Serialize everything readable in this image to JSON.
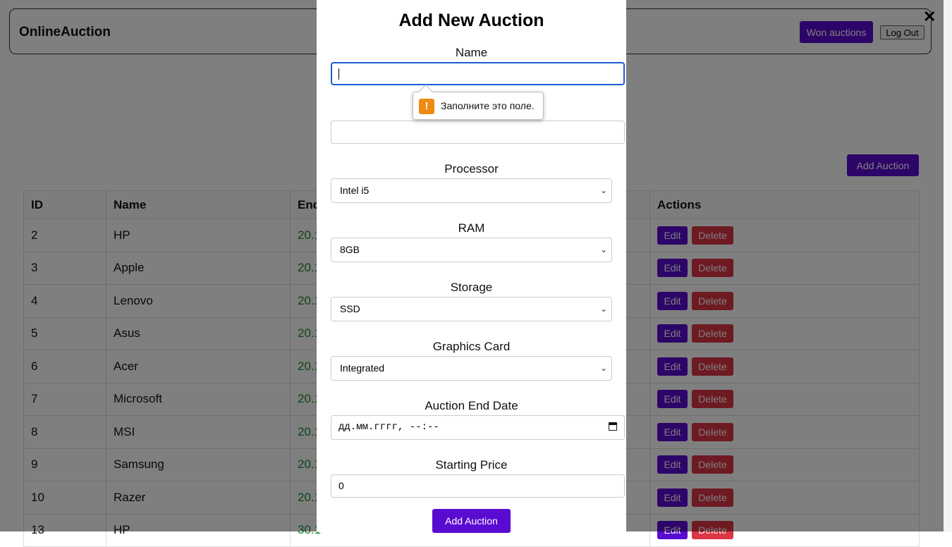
{
  "app": {
    "brand": "OnlineAuction",
    "won_auctions_label": "Won auctions",
    "logout_label": "Log Out",
    "add_auction_label": "Add Auction"
  },
  "table": {
    "headers": [
      "ID",
      "Name",
      "End",
      "Actions"
    ],
    "edit_label": "Edit",
    "delete_label": "Delete",
    "rows": [
      {
        "id": "2",
        "name": "HP",
        "end": "20.1"
      },
      {
        "id": "3",
        "name": "Apple",
        "end": "20.1"
      },
      {
        "id": "4",
        "name": "Lenovo",
        "end": "20.1"
      },
      {
        "id": "5",
        "name": "Asus",
        "end": "20.1"
      },
      {
        "id": "6",
        "name": "Acer",
        "end": "20.1"
      },
      {
        "id": "7",
        "name": "Microsoft",
        "end": "20.1"
      },
      {
        "id": "8",
        "name": "MSI",
        "end": "20.1"
      },
      {
        "id": "9",
        "name": "Samsung",
        "end": "20.1"
      },
      {
        "id": "10",
        "name": "Razer",
        "end": "20.1"
      },
      {
        "id": "13",
        "name": "HP",
        "end": "30.1"
      }
    ]
  },
  "modal": {
    "close_glyph": "✕",
    "title": "Add New Auction",
    "name_label": "Name",
    "name_value": "",
    "tooltip_text": "Заполните это поле.",
    "processor_label": "Processor",
    "processor_value": "Intel i5",
    "ram_label": "RAM",
    "ram_value": "8GB",
    "storage_label": "Storage",
    "storage_value": "SSD",
    "graphics_label": "Graphics Card",
    "graphics_value": "Integrated",
    "end_date_label": "Auction End Date",
    "end_date_placeholder": "дд.мм.гггг, --:--",
    "price_label": "Starting Price",
    "price_value": "0",
    "submit_label": "Add Auction"
  },
  "colors": {
    "accent": "#5a0bd1",
    "danger": "#dc3545",
    "date_green": "#1e8a2a",
    "focus_blue": "#1a5fd1",
    "warning_orange": "#f08a13"
  }
}
